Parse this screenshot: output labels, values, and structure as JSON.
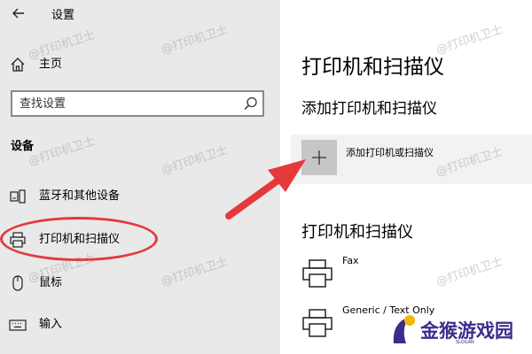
{
  "window": {
    "title": "设置",
    "back_icon": "arrow-left-icon"
  },
  "sidebar": {
    "home_label": "主页",
    "home_icon": "home-icon",
    "search": {
      "placeholder": "查找设置",
      "icon": "search-icon"
    },
    "section_heading": "设备",
    "items": [
      {
        "label": "蓝牙和其他设备",
        "icon": "bluetooth-devices-icon"
      },
      {
        "label": "打印机和扫描仪",
        "icon": "printer-icon"
      },
      {
        "label": "鼠标",
        "icon": "mouse-icon"
      },
      {
        "label": "输入",
        "icon": "keyboard-icon"
      }
    ]
  },
  "main": {
    "page_title": "打印机和扫描仪",
    "add_section_heading": "添加打印机和扫描仪",
    "add_button_label": "添加打印机或扫描仪",
    "add_button_icon": "plus-icon",
    "list_heading": "打印机和扫描仪",
    "devices": [
      {
        "name": "Fax",
        "icon": "printer-icon"
      },
      {
        "name": "Generic / Text Only",
        "icon": "printer-icon"
      }
    ]
  },
  "annotations": {
    "highlight_color": "#e5383b",
    "watermark_text": "@打印机卫士",
    "brand_logo_text": "金猴游戏园",
    "brand_logo_sub": "SLOGAN",
    "brand_color": "#3b2d8c"
  }
}
